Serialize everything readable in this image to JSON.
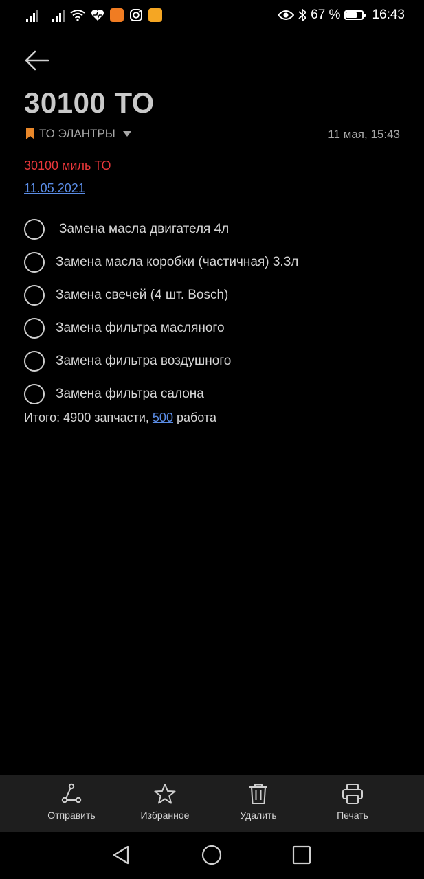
{
  "status_bar": {
    "battery_percent": "67 %",
    "battery_level": 0.67,
    "time": "16:43"
  },
  "note": {
    "title": "30100 ТО",
    "notebook": "ТО ЭЛАНТРЫ",
    "date": "11 мая, 15:43",
    "highlight_line": "30100 миль ТО",
    "link_date": "11.05.2021"
  },
  "checklist": [
    {
      "label": "Замена масла двигателя 4л",
      "checked": false
    },
    {
      "label": "Замена масла коробки (частичная) 3.3л",
      "checked": false
    },
    {
      "label": "Замена свечей (4 шт. Bosch)",
      "checked": false
    },
    {
      "label": "Замена фильтра масляного",
      "checked": false
    },
    {
      "label": "Замена фильтра воздушного",
      "checked": false
    },
    {
      "label": "Замена фильтра салона",
      "checked": false
    }
  ],
  "total": {
    "prefix": "Итого: 4900 запчасти, ",
    "link_number": "500",
    "suffix": " работа"
  },
  "toolbar": {
    "send": "Отправить",
    "favorite": "Избранное",
    "delete": "Удалить",
    "print": "Печать"
  },
  "colors": {
    "accent_red": "#e8373a",
    "link_blue": "#5b8de6",
    "notebook_icon": "#e8872a"
  }
}
